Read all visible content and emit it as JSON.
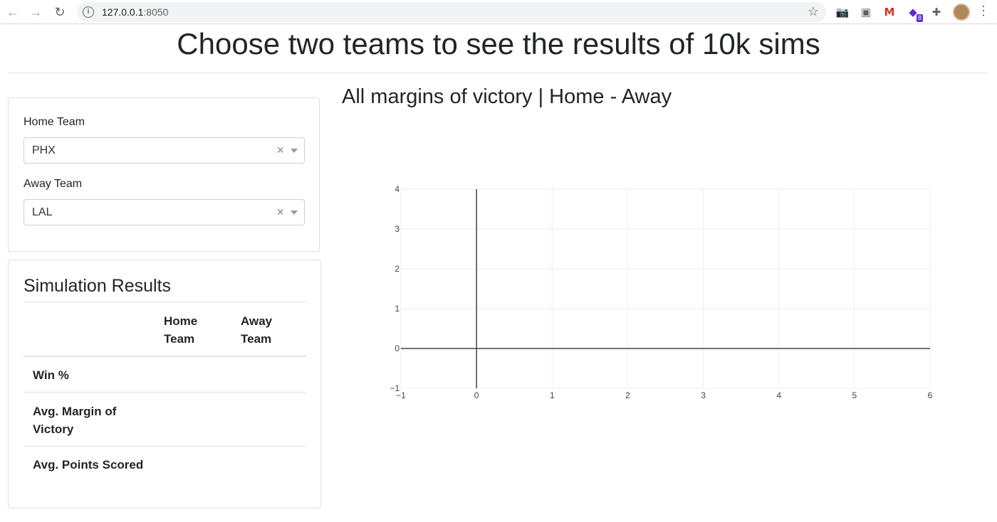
{
  "browser": {
    "url_host": "127.0.0.1",
    "url_port": ":8050",
    "icons": [
      "back-arrow-icon",
      "forward-arrow-icon",
      "reload-icon",
      "info-icon",
      "star-icon",
      "camera-icon",
      "cast-icon",
      "gmail-icon",
      "extension-icon",
      "puzzle-icon",
      "more-icon"
    ],
    "extension_badge": "8"
  },
  "page": {
    "title": "Choose two teams to see the results of 10k sims"
  },
  "controls": {
    "home_label": "Home Team",
    "home_value": "PHX",
    "away_label": "Away Team",
    "away_value": "LAL",
    "clear_glyph": "×"
  },
  "results": {
    "title": "Simulation Results",
    "col_home_1": "Home",
    "col_home_2": "Team",
    "col_away_1": "Away",
    "col_away_2": "Team",
    "rows": [
      {
        "label_1": "Win %",
        "label_2": ""
      },
      {
        "label_1": "Avg. Margin of",
        "label_2": "Victory"
      },
      {
        "label_1": "Avg. Points Scored",
        "label_2": ""
      }
    ]
  },
  "chart_data": {
    "type": "bar",
    "title": "All margins of victory | Home - Away",
    "xlabel": "",
    "ylabel": "",
    "xlim": [
      -1,
      6
    ],
    "ylim": [
      -1,
      4
    ],
    "x_ticks": [
      "−1",
      "0",
      "1",
      "2",
      "3",
      "4",
      "5",
      "6"
    ],
    "y_ticks": [
      "4",
      "3",
      "2",
      "1",
      "0",
      "−1"
    ],
    "series": [],
    "grid": true,
    "gridline_color": "#eeeeee",
    "zeroline_color": "#444444"
  }
}
